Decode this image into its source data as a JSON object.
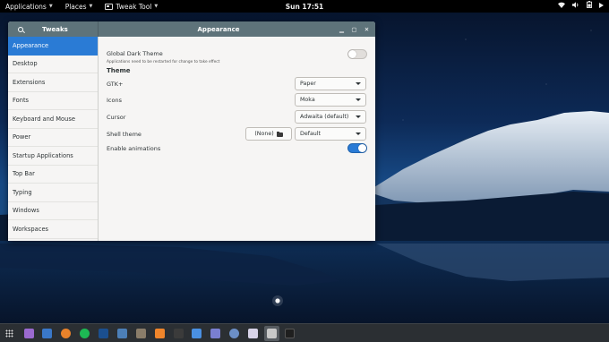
{
  "topbar": {
    "applications": "Applications",
    "places": "Places",
    "tweak_tool": "Tweak Tool",
    "clock": "Sun 17:51",
    "status_icons": [
      "wifi-icon",
      "volume-icon",
      "battery-icon",
      "power-icon"
    ]
  },
  "window": {
    "sidebar_title": "Tweaks",
    "title": "Appearance",
    "controls": [
      "minimize-icon",
      "maximize-icon",
      "close-icon"
    ]
  },
  "sidebar": {
    "items": [
      {
        "label": "Appearance",
        "active": true
      },
      {
        "label": "Desktop"
      },
      {
        "label": "Extensions"
      },
      {
        "label": "Fonts"
      },
      {
        "label": "Keyboard and Mouse"
      },
      {
        "label": "Power"
      },
      {
        "label": "Startup Applications"
      },
      {
        "label": "Top Bar"
      },
      {
        "label": "Typing"
      },
      {
        "label": "Windows"
      },
      {
        "label": "Workspaces"
      }
    ]
  },
  "appearance": {
    "global_dark_theme": {
      "label": "Global Dark Theme",
      "note": "Applications need to be restarted for change to take effect",
      "on": false
    },
    "theme_section": "Theme",
    "gtk": {
      "label": "GTK+",
      "value": "Paper"
    },
    "icons": {
      "label": "Icons",
      "value": "Moka"
    },
    "cursor": {
      "label": "Cursor",
      "value": "Adwaita (default)"
    },
    "shell_theme": {
      "label": "Shell theme",
      "file_button": "(None)",
      "value": "Default"
    },
    "enable_animations": {
      "label": "Enable animations",
      "on": true
    }
  },
  "colors": {
    "accent": "#2a7bd5",
    "headerbar": "#5e737a"
  },
  "dock": {
    "apps": [
      "show-applications-icon",
      "files-icon",
      "mail-icon",
      "firefox-icon",
      "spotify-icon",
      "steam-icon",
      "photo-viewer-icon",
      "vlc-icon",
      "media-player-icon",
      "document-viewer-icon",
      "text-editor-icon",
      "settings-icon",
      "image-editor-icon",
      "tweak-tool-icon",
      "terminal-icon"
    ]
  }
}
